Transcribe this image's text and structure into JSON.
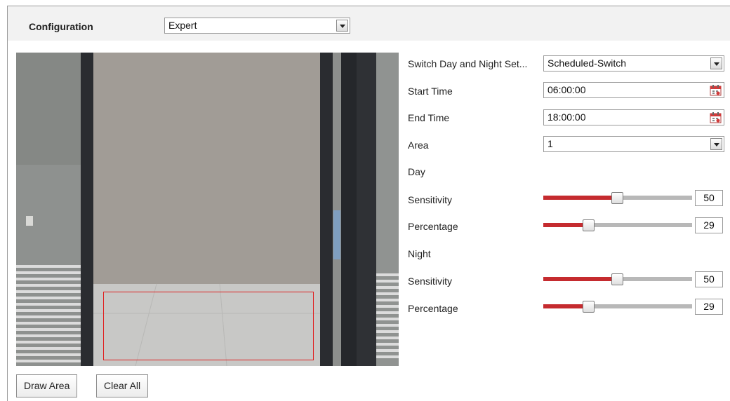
{
  "config": {
    "label": "Configuration",
    "mode_value": "Expert"
  },
  "form": {
    "switch_label": "Switch Day and Night Set...",
    "switch_value": "Scheduled-Switch",
    "start_time_label": "Start Time",
    "start_time_value": "06:00:00",
    "end_time_label": "End Time",
    "end_time_value": "18:00:00",
    "area_label": "Area",
    "area_value": "1",
    "day_heading": "Day",
    "night_heading": "Night",
    "day_sensitivity_label": "Sensitivity",
    "day_sensitivity_value": "50",
    "day_percentage_label": "Percentage",
    "day_percentage_value": "29",
    "night_sensitivity_label": "Sensitivity",
    "night_sensitivity_value": "50",
    "night_percentage_label": "Percentage",
    "night_percentage_value": "29"
  },
  "buttons": {
    "draw_area": "Draw Area",
    "clear_all": "Clear All"
  },
  "colors": {
    "accent_red": "#c52b2f",
    "track_grey": "#b8b8b8"
  },
  "icons": {
    "calendar": "calendar-icon",
    "dropdown": "chevron-down-icon"
  }
}
